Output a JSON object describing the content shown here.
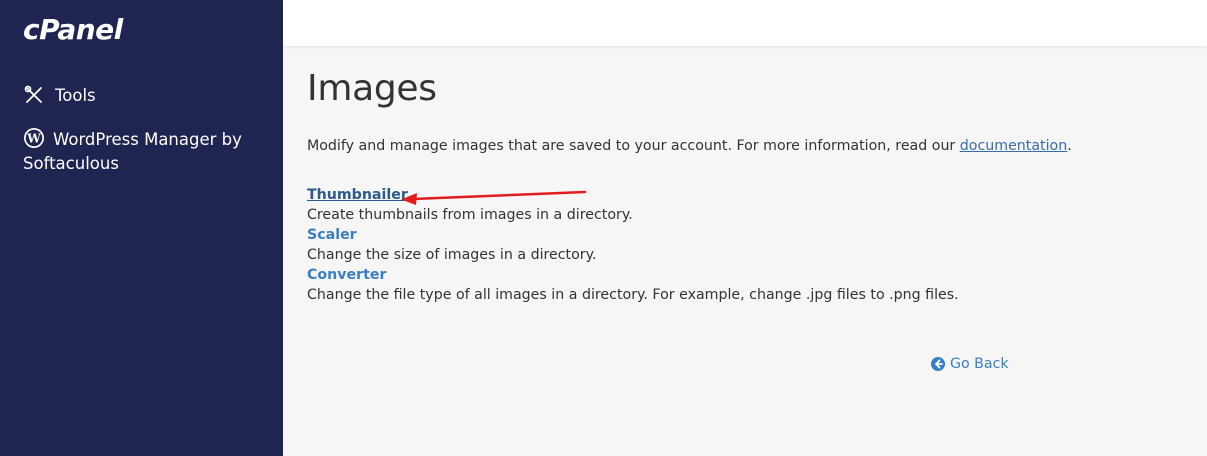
{
  "sidebar": {
    "logo": "cPanel",
    "items": [
      {
        "label": "Tools",
        "icon": "tools-icon"
      },
      {
        "label": "WordPress Manager by Softaculous",
        "icon": "wordpress-icon"
      }
    ]
  },
  "main": {
    "title": "Images",
    "intro_text": "Modify and manage images that are saved to your account. For more information, read our ",
    "intro_link": "documentation",
    "intro_end": ".",
    "tools": [
      {
        "label": "Thumbnailer",
        "description": "Create thumbnails from images in a directory."
      },
      {
        "label": "Scaler",
        "description": "Change the size of images in a directory."
      },
      {
        "label": "Converter",
        "description": "Change the file type of all images in a directory. For example, change .jpg files to .png files."
      }
    ],
    "go_back": "Go Back"
  },
  "colors": {
    "sidebar_bg": "#1f2451",
    "link": "#3a7fc1",
    "annotation_arrow": "#e11d1d"
  }
}
